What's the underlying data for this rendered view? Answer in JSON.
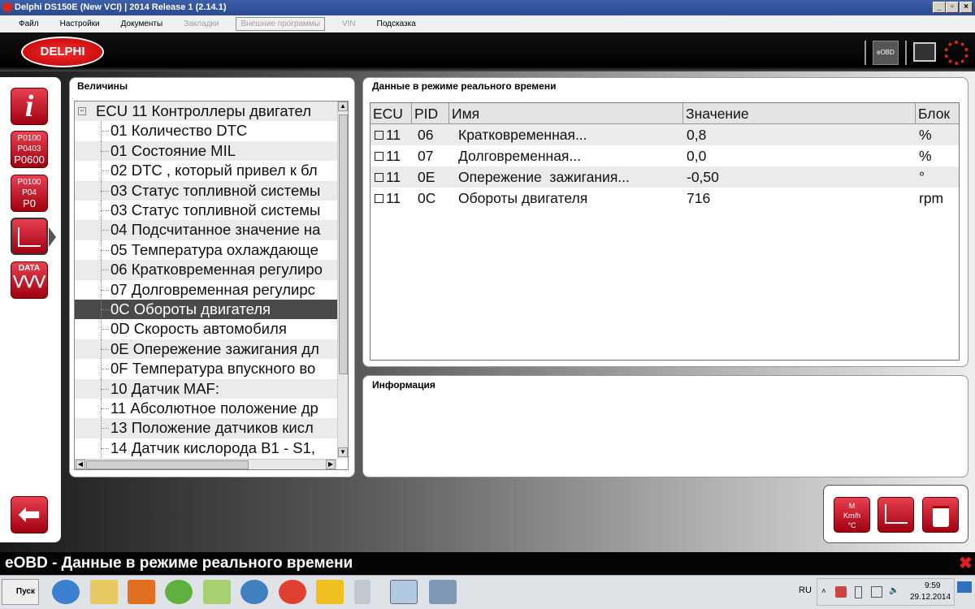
{
  "window": {
    "title": "Delphi DS150E (New VCI) | 2014 Release 1 (2.14.1)",
    "min": "_",
    "max": "▫",
    "close": "×"
  },
  "menu": [
    "Файл",
    "Настройки",
    "Документы",
    "Закладки",
    "Внешние программы",
    "VIN",
    "Подсказка"
  ],
  "header": {
    "logo": "DELPHI",
    "eobd": "eOBD"
  },
  "sidebar": {
    "info": "i",
    "dtc": [
      "P0100",
      "P0403",
      "P0600"
    ],
    "clear": [
      "P0100",
      "P04",
      "P0"
    ],
    "data": "DATA"
  },
  "tree": {
    "title": "Величины",
    "root": "ECU 11 Контроллеры двигател",
    "items": [
      "01 Количество DTC",
      "01 Состояние MIL",
      "02 DTC , который привел к бл",
      "03 Статус топливной системы",
      "03 Статус топливной системы",
      "04 Подсчитанное значение на",
      "05 Температура охлаждающе",
      "06 Кратковременная регулиро",
      "07 Долговременная регулирс",
      "0C Обороты двигателя",
      "0D Скорость автомобиля",
      "0E Опережение зажигания дл",
      "0F Температура впускного во",
      "10 Датчик MAF:",
      "11 Абсолютное положение др",
      "13 Положение датчиков кисл",
      "14 Датчик кислорода B1 - S1,"
    ],
    "selected_index": 9
  },
  "realtime": {
    "title": "Данные в режиме реального времени",
    "columns": [
      "ECU",
      "PID",
      "Имя",
      "Значение",
      "Блок"
    ],
    "rows": [
      {
        "ecu": "11",
        "pid": "06",
        "name": "Кратковременная...",
        "value": "0,8",
        "unit": "%"
      },
      {
        "ecu": "11",
        "pid": "07",
        "name": "Долговременная...",
        "value": "0,0",
        "unit": "%"
      },
      {
        "ecu": "11",
        "pid": "0E",
        "name": "Опережение  зажигания...",
        "value": "-0,50",
        "unit": "°"
      },
      {
        "ecu": "11",
        "pid": "0C",
        "name": "Обороты двигателя",
        "value": "716",
        "unit": "rpm"
      }
    ]
  },
  "info": {
    "title": "Информация"
  },
  "status": {
    "text": "eOBD - Данные в режиме реального времени"
  },
  "taskbar": {
    "start": "Пуск",
    "lang": "RU",
    "time": "9:59",
    "date": "29.12.2014"
  }
}
